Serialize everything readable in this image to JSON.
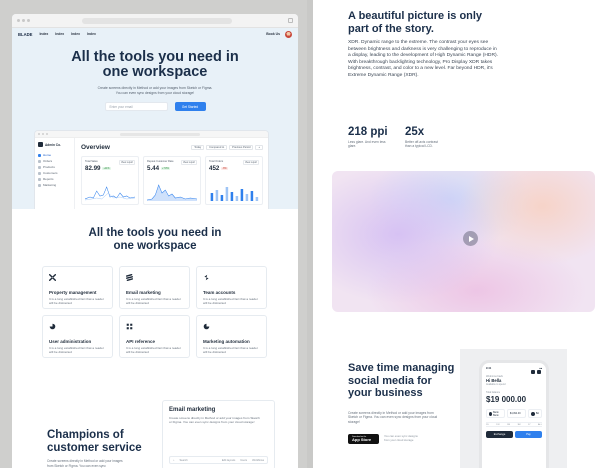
{
  "left_board": {
    "nav": {
      "logo": "BLADE",
      "links": [
        "Index",
        "Index",
        "Index",
        "Index"
      ],
      "right_label": "Book Us"
    },
    "hero": {
      "title": "All the tools you need in one workspace",
      "subtitle_line1": "Create screens directly in Method or add your images from Sketch or Figma.",
      "subtitle_line2": "You can even sync designs from your cloud storage!",
      "email_placeholder": "Enter your email",
      "cta": "Get Started"
    },
    "app_preview": {
      "brand": "Admin Co.",
      "sidebar": [
        "Home",
        "Orders",
        "Products",
        "Customers",
        "Reports",
        "Marketing"
      ],
      "overview_title": "Overview",
      "toolbar": [
        "Today",
        "Compared to",
        "Previous Period",
        "+"
      ],
      "cards": [
        {
          "title": "Total Sales",
          "value": "82.99",
          "badge": "+11%",
          "chip": "View report",
          "badge_color": "green"
        },
        {
          "title": "Repeat Customer Rate",
          "value": "5.44",
          "badge": "+7.8%",
          "chip": "View report",
          "badge_color": "green"
        },
        {
          "title": "Total Orders",
          "value": "452",
          "badge": "-8%",
          "chip": "View report",
          "badge_color": "red"
        }
      ]
    },
    "features": {
      "title": "All the tools you need in one workspace",
      "items": [
        {
          "title": "Property management",
          "desc": "It is a long established fact that a reader will be distracted",
          "icon": "cross-icon"
        },
        {
          "title": "Email marketing",
          "desc": "It is a long established fact that a reader will be distracted",
          "icon": "stripes-icon"
        },
        {
          "title": "Team accounts",
          "desc": "It is a long established fact that a reader will be distracted",
          "icon": "bolt-icon"
        },
        {
          "title": "User administration",
          "desc": "It is a long established fact that a reader will be distracted",
          "icon": "pie-icon"
        },
        {
          "title": "API reference",
          "desc": "It is a long established fact that a reader will be distracted",
          "icon": "grid-icon"
        },
        {
          "title": "Marketing automation",
          "desc": "It is a long established fact that a reader will be distracted",
          "icon": "leaf-icon"
        }
      ]
    },
    "champions": {
      "title": "Champions of customer service",
      "subtitle": "Create screens directly in Method or add your images from Sketch or Figma. You can even sync"
    },
    "email_card": {
      "title": "Email marketing",
      "desc": "Create screens directly in Method or add your images from Sketch or Figma. You can even sync designs from your cloud storage!",
      "bar_items": [
        "Search",
        "Edit layouts",
        "Users",
        "Workflows"
      ]
    }
  },
  "right_board": {
    "story": {
      "title": "A beautiful picture is only part of the story.",
      "body": "XDR. Dynamic range to the extreme. The contrast your eyes see between brightness and darkness is very challenging to reproduce in a display, leading to the development of High Dynamic Range (HDR). With breakthrough backlighting technology, Pro Display XDR takes brightness, contrast, and color to a new level. Far beyond HDR, it's Extreme Dynamic Range (XDR)."
    },
    "stats": [
      {
        "value": "218 ppi",
        "desc": "Less glare. And even less glare."
      },
      {
        "value": "25x",
        "desc": "Better off-axis contrast than a typical LCD."
      }
    ],
    "video": {
      "play_icon": "play-icon"
    },
    "save": {
      "title": "Save time managing social media for your business",
      "subtitle": "Create screens directly in Method or add your images from Sketch or Figma. You can even sync designs from your cloud storage!",
      "store_small": "Download on the",
      "store_big": "App Store",
      "store_note": "You can even sync designs from your cloud storage"
    },
    "phone": {
      "time": "9:41",
      "greeting_small": "Welcome back",
      "name": "Hi Bella",
      "subtitle": "Available to spend",
      "balance_label": "Total balance",
      "balance": "$19 000.00",
      "pills": [
        "Bank Bank",
        "$4,094.00",
        "BA"
      ],
      "range": [
        "1D",
        "1W",
        "1M",
        "3M",
        "1Y",
        "ALL"
      ],
      "buttons": [
        "Exchange",
        "Pay"
      ]
    }
  },
  "colors": {
    "heading": "#1b2f4a",
    "accent": "#2f80ed",
    "page_bg": "#c9c9c7"
  }
}
